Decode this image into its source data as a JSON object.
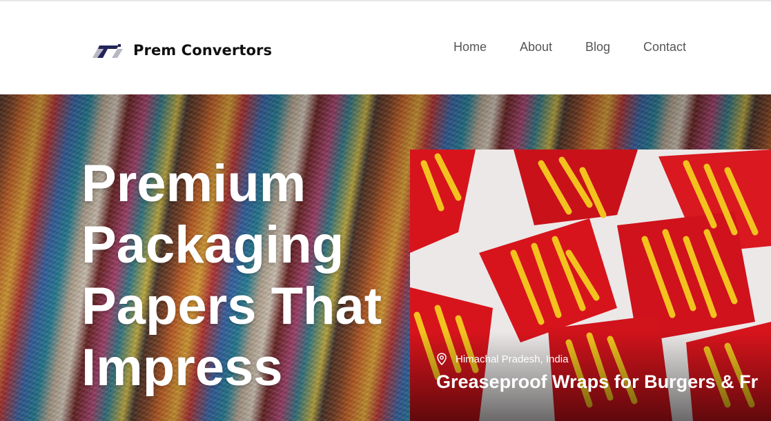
{
  "header": {
    "brand_name": "Prem Convertors",
    "logo_icon": "prem-convertors-logo",
    "nav": [
      {
        "label": "Home"
      },
      {
        "label": "About"
      },
      {
        "label": "Blog"
      },
      {
        "label": "Contact"
      }
    ]
  },
  "hero": {
    "title_lines": [
      "Premium",
      "Packaging",
      "Papers That",
      "Impress"
    ],
    "background": "colorful tie-dye papers"
  },
  "card": {
    "location": "Himachal Pradesh, India",
    "location_icon": "map-pin-icon",
    "title": "Greaseproof Wraps for Burgers & Fr",
    "image": "french fries in red wraps"
  },
  "colors": {
    "nav_text": "#555555",
    "brand_text": "#111111",
    "logo_dark": "#23255a",
    "logo_light": "#b8b8c4",
    "wrap_red": "#d7141c",
    "fries_yellow": "#f3c21f"
  }
}
